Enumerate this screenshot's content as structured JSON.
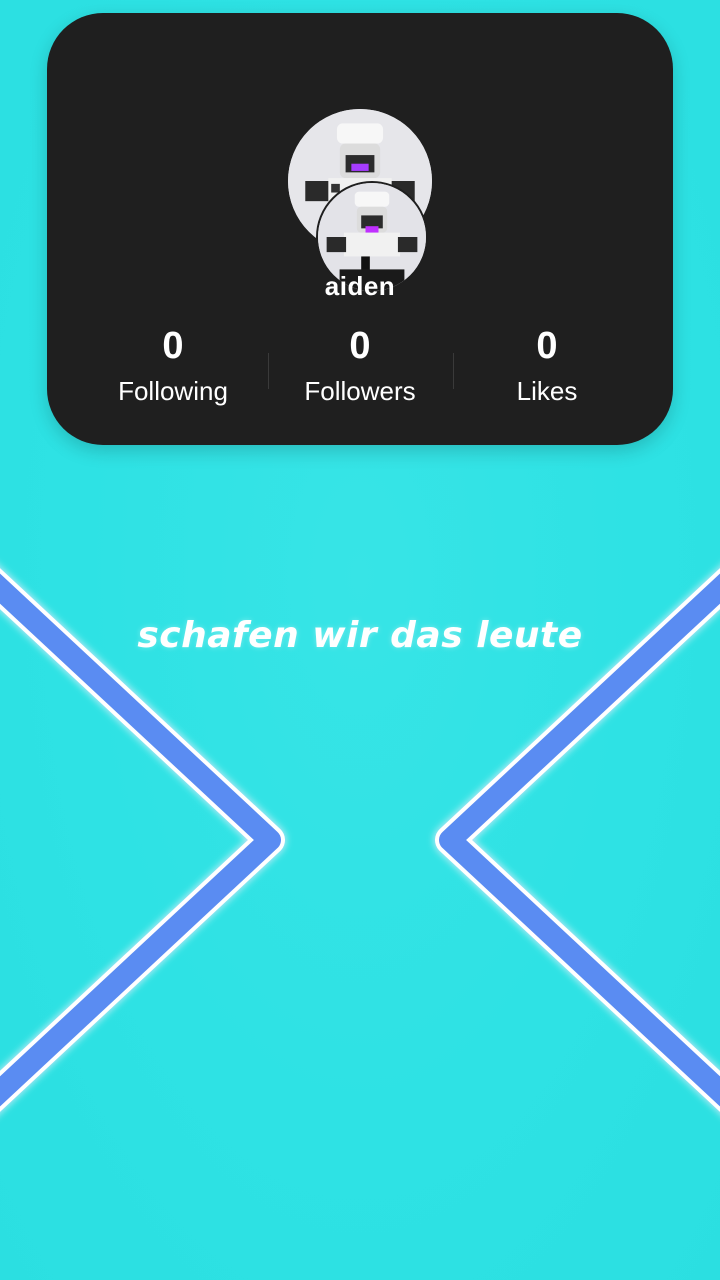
{
  "profile": {
    "username": "aiden",
    "stats": [
      {
        "value": "0",
        "label": "Following"
      },
      {
        "value": "0",
        "label": "Followers"
      },
      {
        "value": "0",
        "label": "Likes"
      }
    ]
  },
  "caption": "schafen wir das leute",
  "colors": {
    "background": "#2ee2e4",
    "card": "#1f1f1f",
    "neon": "#5a8cf2",
    "neon_outline": "#ffffff",
    "text": "#ffffff"
  },
  "icons": {
    "avatar": "roblox-avatar-image",
    "decor_left": "neon-chevron-right",
    "decor_right": "neon-chevron-left"
  }
}
